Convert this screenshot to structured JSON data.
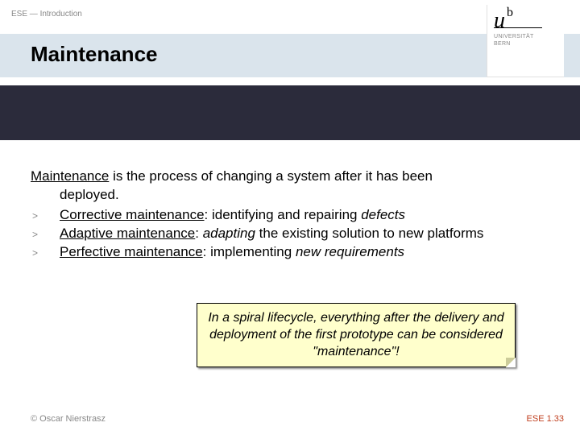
{
  "header": {
    "breadcrumb": "ESE — Introduction",
    "title": "Maintenance"
  },
  "logo": {
    "u": "u",
    "b": "b",
    "line1": "UNIVERSITÄT",
    "line2": "BERN"
  },
  "body": {
    "intro_underlined": "Maintenance",
    "intro_rest": " is the process of changing a system after it has been",
    "intro_hang": "deployed.",
    "items": [
      {
        "mark": ">",
        "u": "Corrective maintenance",
        "plain1": ": identifying and repairing ",
        "em": "defects",
        "plain2": ""
      },
      {
        "mark": ">",
        "u": "Adaptive maintenance",
        "plain1": ": ",
        "em": "adapting",
        "plain2": " the existing solution to new platforms"
      },
      {
        "mark": ">",
        "u": "Perfective maintenance",
        "plain1": ": implementing ",
        "em": "new requirements",
        "plain2": ""
      }
    ]
  },
  "callout": {
    "text": "In a spiral lifecycle, everything after the delivery and deployment of the first prototype can be considered \"maintenance\"!"
  },
  "footer": {
    "left": "© Oscar Nierstrasz",
    "right": "ESE 1.33"
  }
}
